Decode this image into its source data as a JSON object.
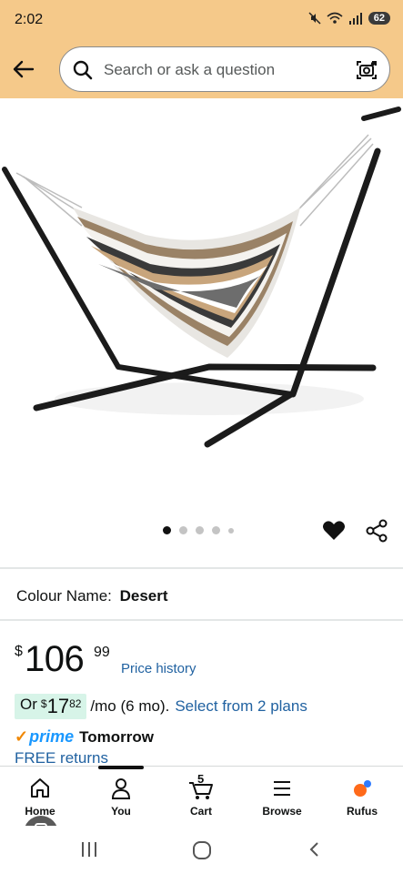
{
  "status_bar": {
    "time": "2:02",
    "battery": "62"
  },
  "header": {
    "search_placeholder": "Search or ask a question"
  },
  "icons": {
    "back": "back-arrow-icon",
    "search": "search-icon",
    "lens": "camera-lens-icon",
    "heart": "heart-icon",
    "share": "share-icon"
  },
  "gallery": {
    "dot_count": 5,
    "active_index": 0
  },
  "product": {
    "colour_label": "Colour Name:",
    "colour_value": "Desert",
    "price_symbol": "$",
    "price_whole": "106",
    "price_fraction": "99",
    "price_history": "Price history",
    "plan_or": "Or",
    "plan_symbol": "$",
    "plan_whole": "17",
    "plan_fraction": "82",
    "plan_term": "/mo (6 mo).",
    "plan_link": "Select from 2 plans",
    "prime_word": "prime",
    "delivery": "Tomorrow",
    "returns": "FREE returns"
  },
  "bottom_nav": {
    "items": [
      {
        "label": "Home",
        "icon": "home-icon"
      },
      {
        "label": "You",
        "icon": "user-icon"
      },
      {
        "label": "Cart",
        "icon": "cart-icon",
        "badge": "5"
      },
      {
        "label": "Browse",
        "icon": "menu-icon"
      },
      {
        "label": "Rufus",
        "icon": "rufus-icon"
      }
    ]
  },
  "colors": {
    "header_bg": "#f5c98a",
    "link": "#2162a1",
    "prime_blue": "#1a98ff",
    "prime_check": "#f08804",
    "plan_highlight": "#d7f4e8"
  }
}
